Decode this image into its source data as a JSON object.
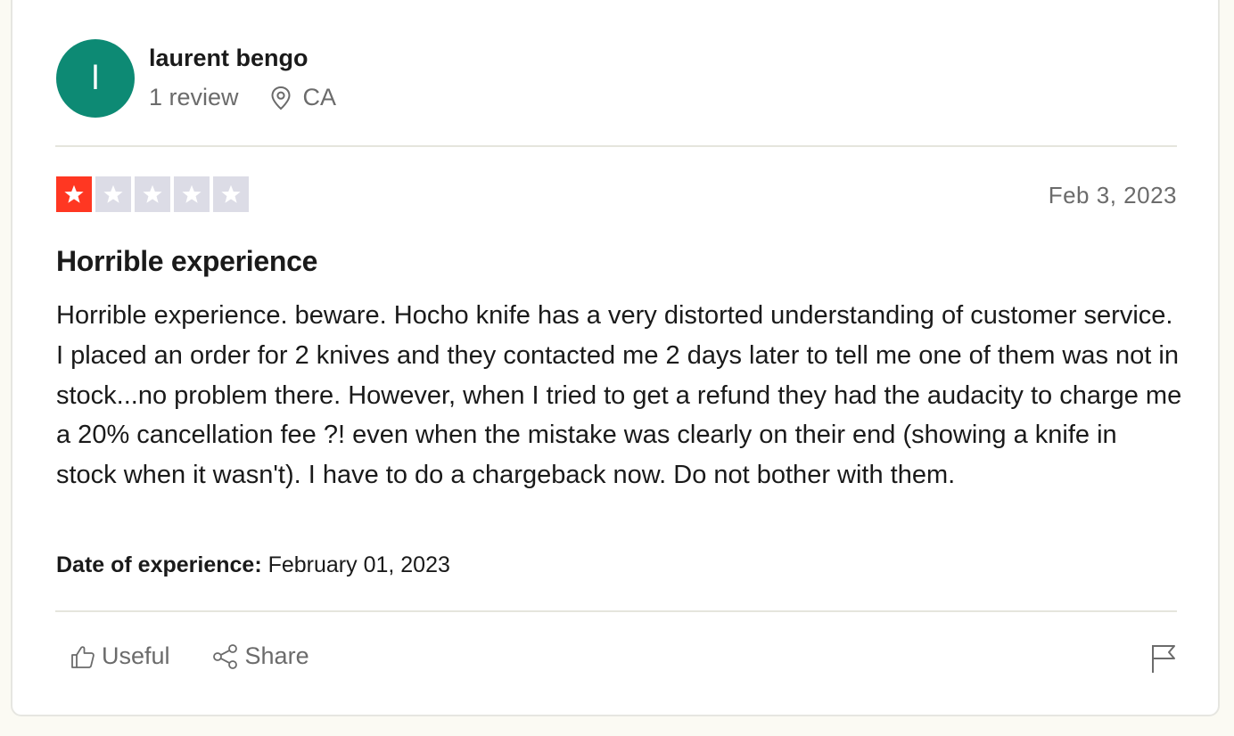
{
  "reviewer": {
    "avatar_initial": "l",
    "avatar_color": "#0d8a74",
    "name": "laurent bengo",
    "review_count": "1 review",
    "location": "CA",
    "location_icon": "map-pin-icon"
  },
  "review": {
    "rating": 1,
    "rating_max": 5,
    "star_active_color": "#ff3722",
    "star_inactive_color": "#dcdce6",
    "date": "Feb 3, 2023",
    "title": "Horrible experience",
    "body": "Horrible experience. beware. Hocho knife has a very distorted understanding of customer service. I placed an order for 2 knives and they contacted me 2 days later to tell me one of them was not in stock...no problem there. However, when I tried to get a refund they had the audacity to charge me a 20% cancellation fee ?! even when the mistake was clearly on their end (showing a knife in stock when it wasn't). I have to do a chargeback now. Do not bother with them.",
    "experience_label": "Date of experience:",
    "experience_date": "February 01, 2023"
  },
  "actions": {
    "useful_label": "Useful",
    "useful_icon": "thumbs-up-icon",
    "share_label": "Share",
    "share_icon": "share-icon",
    "report_icon": "flag-icon"
  }
}
